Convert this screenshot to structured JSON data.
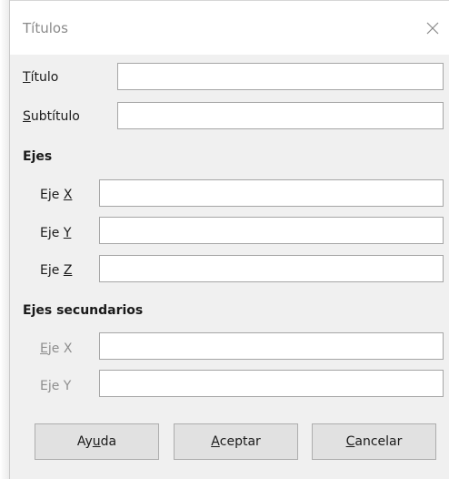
{
  "dialog": {
    "title": "Títulos",
    "close_glyph": "×",
    "close_icon": "close-icon"
  },
  "fields": {
    "titulo": {
      "label_mnemonic": "T",
      "label_rest": "ítulo",
      "value": ""
    },
    "subtitulo": {
      "label_mnemonic": "S",
      "label_rest": "ubtítulo",
      "value": ""
    }
  },
  "ejes": {
    "heading": "Ejes",
    "x": {
      "label_prefix": "Eje ",
      "label_mnemonic": "X",
      "value": ""
    },
    "y": {
      "label_prefix": "Eje ",
      "label_mnemonic": "Y",
      "value": ""
    },
    "z": {
      "label_prefix": "Eje ",
      "label_mnemonic": "Z",
      "value": ""
    }
  },
  "ejes_secundarios": {
    "heading": "Ejes secundarios",
    "x": {
      "label_mnemonic": "E",
      "label_rest": "je X",
      "value": ""
    },
    "y": {
      "label": "Eje Y",
      "value": ""
    }
  },
  "buttons": {
    "ayuda": {
      "pre": "Ay",
      "mnemonic": "u",
      "post": "da"
    },
    "aceptar": {
      "pre": "",
      "mnemonic": "A",
      "post": "ceptar"
    },
    "cancelar": {
      "pre": "",
      "mnemonic": "C",
      "post": "ancelar"
    }
  },
  "colors": {
    "dialog_bg": "#f0f0f0",
    "titlebar_bg": "#ffffff",
    "disabled_text": "#8e8e8e"
  }
}
